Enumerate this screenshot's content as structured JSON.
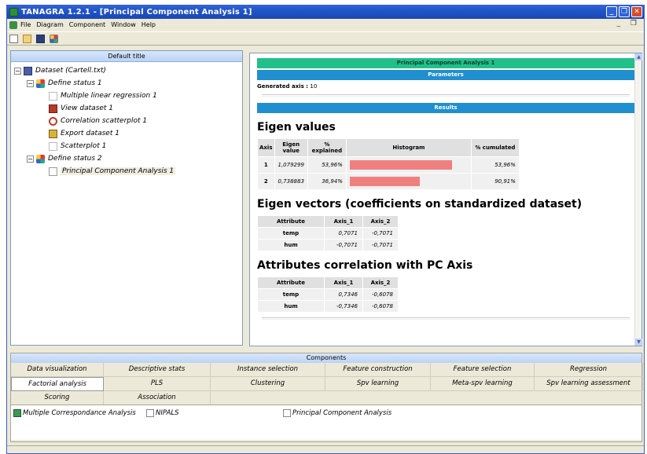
{
  "window": {
    "title": "TANAGRA 1.2.1 - [Principal Component Analysis 1]",
    "min_label": "_",
    "restore_label": "❐",
    "close_label": "✕"
  },
  "menu": {
    "items": [
      "File",
      "Diagram",
      "Component",
      "Window",
      "Help"
    ],
    "mdi_controls": "_ ❐"
  },
  "toolbar": {
    "icons": [
      "new-icon",
      "open-icon",
      "save-icon",
      "define-status-icon"
    ]
  },
  "tree": {
    "header": "Default title",
    "nodes": [
      {
        "label": "Dataset (Cartell.txt)",
        "icon": "dataset-icon",
        "expander": "−"
      },
      {
        "label": "Define status 1",
        "icon": "define-status-icon",
        "expander": "−"
      },
      {
        "label": "Multiple linear regression 1",
        "icon": "regression-icon"
      },
      {
        "label": "View dataset 1",
        "icon": "view-dataset-icon"
      },
      {
        "label": "Correlation scatterplot 1",
        "icon": "correlation-icon"
      },
      {
        "label": "Export dataset 1",
        "icon": "export-icon"
      },
      {
        "label": "Scatterplot 1",
        "icon": "scatterplot-icon"
      },
      {
        "label": "Define status 2",
        "icon": "define-status-icon",
        "expander": "−"
      },
      {
        "label": "Principal Component Analysis 1",
        "icon": "pca-icon"
      }
    ]
  },
  "report": {
    "title_band": "Principal Component Analysis 1",
    "parameters_band": "Parameters",
    "generated_axis_label": "Generated axis :",
    "generated_axis_value": "10",
    "results_band": "Results",
    "eigen_title": "Eigen values",
    "eigen_headers": [
      "Axis",
      "Eigen value",
      "% explained",
      "Histogram",
      "% cumulated"
    ],
    "eigen_rows": [
      {
        "axis": "1",
        "eigen": "1,079299",
        "explained": "53,96%",
        "bar_fraction": 0.5396,
        "cumulated": "53,96%"
      },
      {
        "axis": "2",
        "eigen": "0,738883",
        "explained": "36,94%",
        "bar_fraction": 0.3694,
        "cumulated": "90,91%"
      }
    ],
    "vectors_title": "Eigen vectors (coefficients on standardized dataset)",
    "vectors_headers": [
      "Attribute",
      "Axis_1",
      "Axis_2"
    ],
    "vectors_rows": [
      {
        "attr": "temp",
        "a1": "0,7071",
        "a2": "-0,7071"
      },
      {
        "attr": "hum",
        "a1": "-0,7071",
        "a2": "-0,7071"
      }
    ],
    "corr_title": "Attributes correlation with PC Axis",
    "corr_headers": [
      "Attribute",
      "Axis_1",
      "Axis_2"
    ],
    "corr_rows": [
      {
        "attr": "temp",
        "a1": "0,7346",
        "a2": "-0,6078"
      },
      {
        "attr": "hum",
        "a1": "-0,7346",
        "a2": "-0,6078"
      }
    ]
  },
  "components": {
    "header": "Components",
    "tabs": [
      "Data visualization",
      "Descriptive stats",
      "Instance selection",
      "Feature construction",
      "Feature selection",
      "Regression",
      "Factorial analysis",
      "PLS",
      "Clustering",
      "Spv learning",
      "Meta-spv learning",
      "Spv learning assessment",
      "Scoring",
      "Association"
    ],
    "active_tab": "Factorial analysis",
    "methods": [
      "Multiple Correspondance Analysis",
      "NIPALS",
      "Principal Component Analysis"
    ]
  },
  "colors": {
    "title_band": "#21c08a",
    "section_band": "#1f8fd0",
    "histogram_bar": "#f08080"
  }
}
